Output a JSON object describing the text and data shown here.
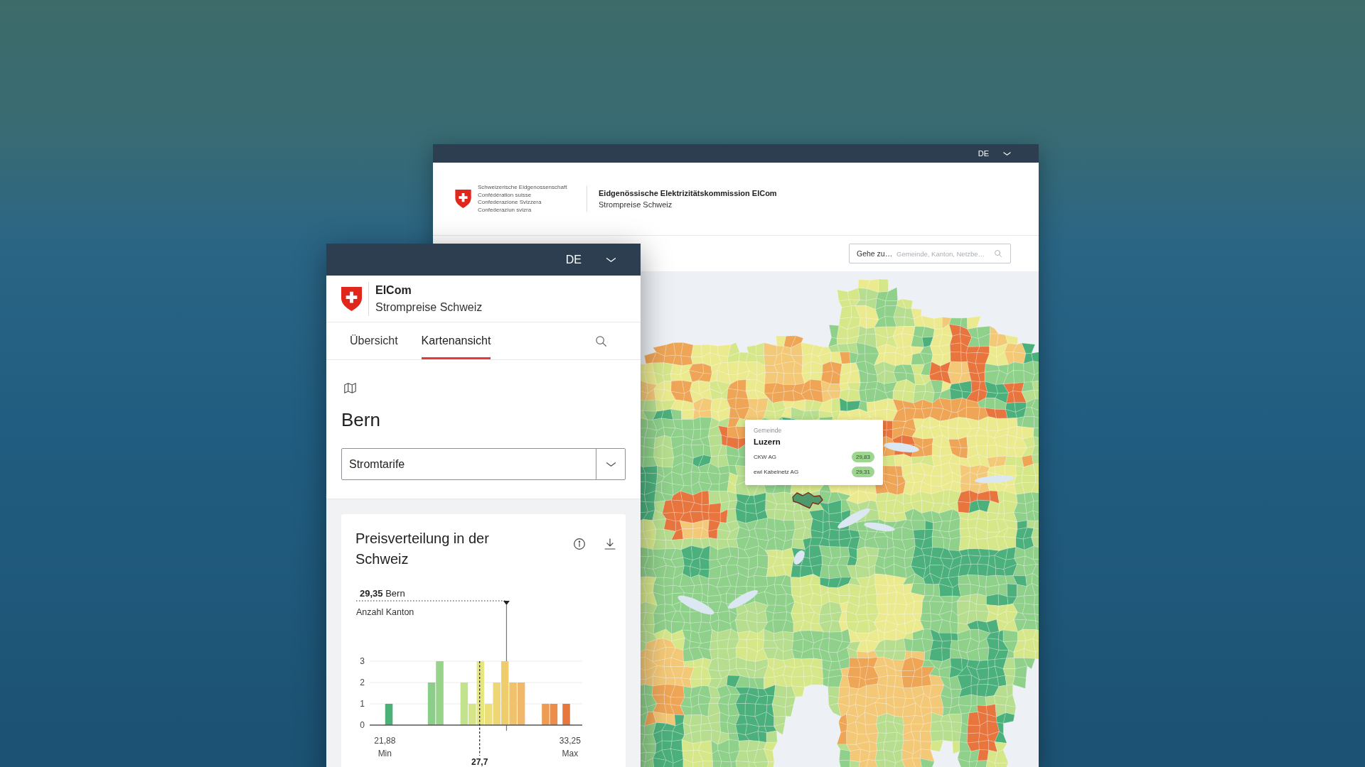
{
  "desktop_window": {
    "language": "DE",
    "brand_lines": [
      "Schweizerische Eidgenossenschaft",
      "Confédération suisse",
      "Confederazione Svizzera",
      "Confederaziun svizra"
    ],
    "title": "Eidgenössische Elektrizitätskommission ElCom",
    "subtitle": "Strompreise Schweiz",
    "search": {
      "label": "Gehe zu…",
      "placeholder": "Gemeinde, Kanton, Netzbe…"
    },
    "map_tooltip": {
      "category": "Gemeinde",
      "name": "Luzern",
      "rows": [
        {
          "operator": "CKW AG",
          "price": "29,83"
        },
        {
          "operator": "ewl Kabelnetz AG",
          "price": "29,31"
        }
      ]
    }
  },
  "mobile_window": {
    "language": "DE",
    "title": "ElCom",
    "subtitle": "Strompreise Schweiz",
    "tabs": [
      {
        "label": "Übersicht",
        "selected": false
      },
      {
        "label": "Kartenansicht",
        "selected": true
      }
    ],
    "location": "Bern",
    "dropdown": {
      "value": "Stromtarife"
    },
    "card": {
      "title": "Preisverteilung in der Schweiz",
      "chart_data": {
        "type": "bar",
        "ylabel": "Anzahl Kanton",
        "x": [
          22.13,
          24.75,
          25.25,
          26.75,
          27.25,
          27.75,
          28.25,
          28.75,
          29.25,
          29.75,
          30.25,
          31.75,
          32.25,
          33.02
        ],
        "values": [
          1,
          2,
          3,
          2,
          1,
          3,
          1,
          2,
          3,
          2,
          2,
          1,
          1,
          1
        ],
        "xlim": [
          20.95,
          34.0
        ],
        "ylim": [
          0,
          3
        ],
        "yticks": [
          0,
          1,
          2,
          3
        ],
        "xticks": [
          {
            "value": 21.88,
            "label": "21,88"
          },
          {
            "value": 33.25,
            "label": "33,25"
          }
        ],
        "ref_lines": [
          {
            "axis": "x",
            "value": 29.35,
            "label": "**29,35** Bern"
          },
          {
            "axis": "x",
            "value": 27.7,
            "label": "27,7"
          }
        ],
        "annotations": [
          "Min",
          "Max"
        ]
      }
    }
  }
}
